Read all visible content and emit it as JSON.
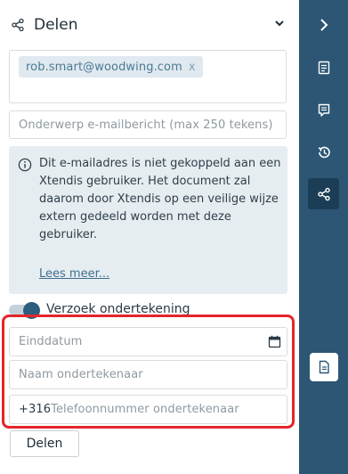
{
  "header": {
    "title": "Delen"
  },
  "recipients": [
    {
      "email": "rob.smart@woodwing.com",
      "remove": "x"
    }
  ],
  "subject": {
    "placeholder": "Onderwerp e-mailbericht (max 250 tekens)"
  },
  "info": {
    "text": "Dit e-mailadres is niet gekoppeld aan een Xtendis gebruiker. Het document zal daarom door Xtendis op een veilige wijze extern gedeeld worden met deze gebruiker.",
    "link": "Lees meer..."
  },
  "signature_toggle": {
    "label": "Verzoek ondertekening",
    "state": "on"
  },
  "fields": {
    "end_date": {
      "placeholder": "Einddatum"
    },
    "signer_name": {
      "placeholder": "Naam ondertekenaar"
    },
    "signer_phone": {
      "prefix": "+316",
      "placeholder": "Telefoonnummer ondertekenaar"
    }
  },
  "share_button": {
    "label": "Delen"
  },
  "rail": {
    "items": [
      {
        "icon": "chevron-right-icon"
      },
      {
        "icon": "document-icon"
      },
      {
        "icon": "comment-icon"
      },
      {
        "icon": "history-icon"
      },
      {
        "icon": "share-icon",
        "active": true
      },
      {
        "icon": "file-icon"
      }
    ]
  },
  "colors": {
    "rail": "#2c5674",
    "highlight": "#e3262b",
    "chip_bg": "#dfe9ef",
    "info_bg": "#e6edf1"
  }
}
